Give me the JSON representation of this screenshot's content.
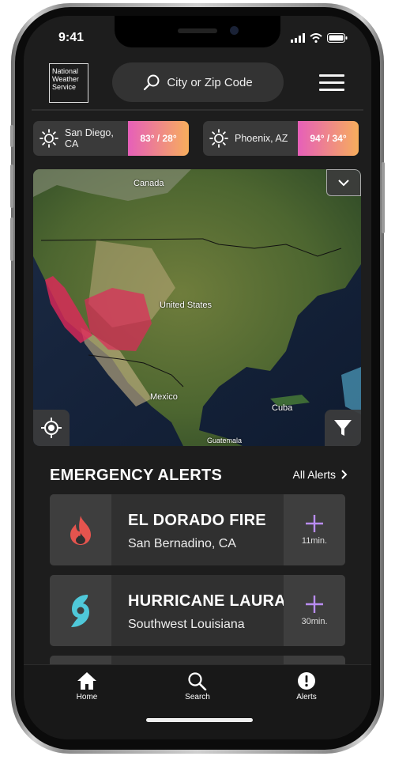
{
  "status": {
    "time": "9:41"
  },
  "header": {
    "logo_lines": [
      "National",
      "Weather",
      "Service"
    ],
    "search_placeholder": "City or Zip Code"
  },
  "cities": [
    {
      "name": "San Diego, CA",
      "temp": "83° / 28°"
    },
    {
      "name": "Phoenix, AZ",
      "temp": "94° / 34°"
    }
  ],
  "map": {
    "labels": {
      "canada": "Canada",
      "us": "United States",
      "mexico": "Mexico",
      "cuba": "Cuba",
      "guatemala": "Guatemala"
    }
  },
  "alerts": {
    "title": "EMERGENCY ALERTS",
    "all_label": "All Alerts",
    "items": [
      {
        "title": "EL DORADO FIRE",
        "location": "San Bernadino, CA",
        "time": "11min.",
        "icon": "fire-icon",
        "color": "#e5544e"
      },
      {
        "title": "HURRICANE LAURA",
        "location": "Southwest Louisiana",
        "time": "30min.",
        "icon": "hurricane-icon",
        "color": "#4fc8d9"
      }
    ]
  },
  "tabs": [
    {
      "label": "Home",
      "icon": "home-icon"
    },
    {
      "label": "Search",
      "icon": "search-icon"
    },
    {
      "label": "Alerts",
      "icon": "alert-icon"
    }
  ],
  "colors": {
    "accent": "#b98cf2",
    "temp_gradient_start": "#e65fb9",
    "temp_gradient_end": "#f7ae5c"
  }
}
